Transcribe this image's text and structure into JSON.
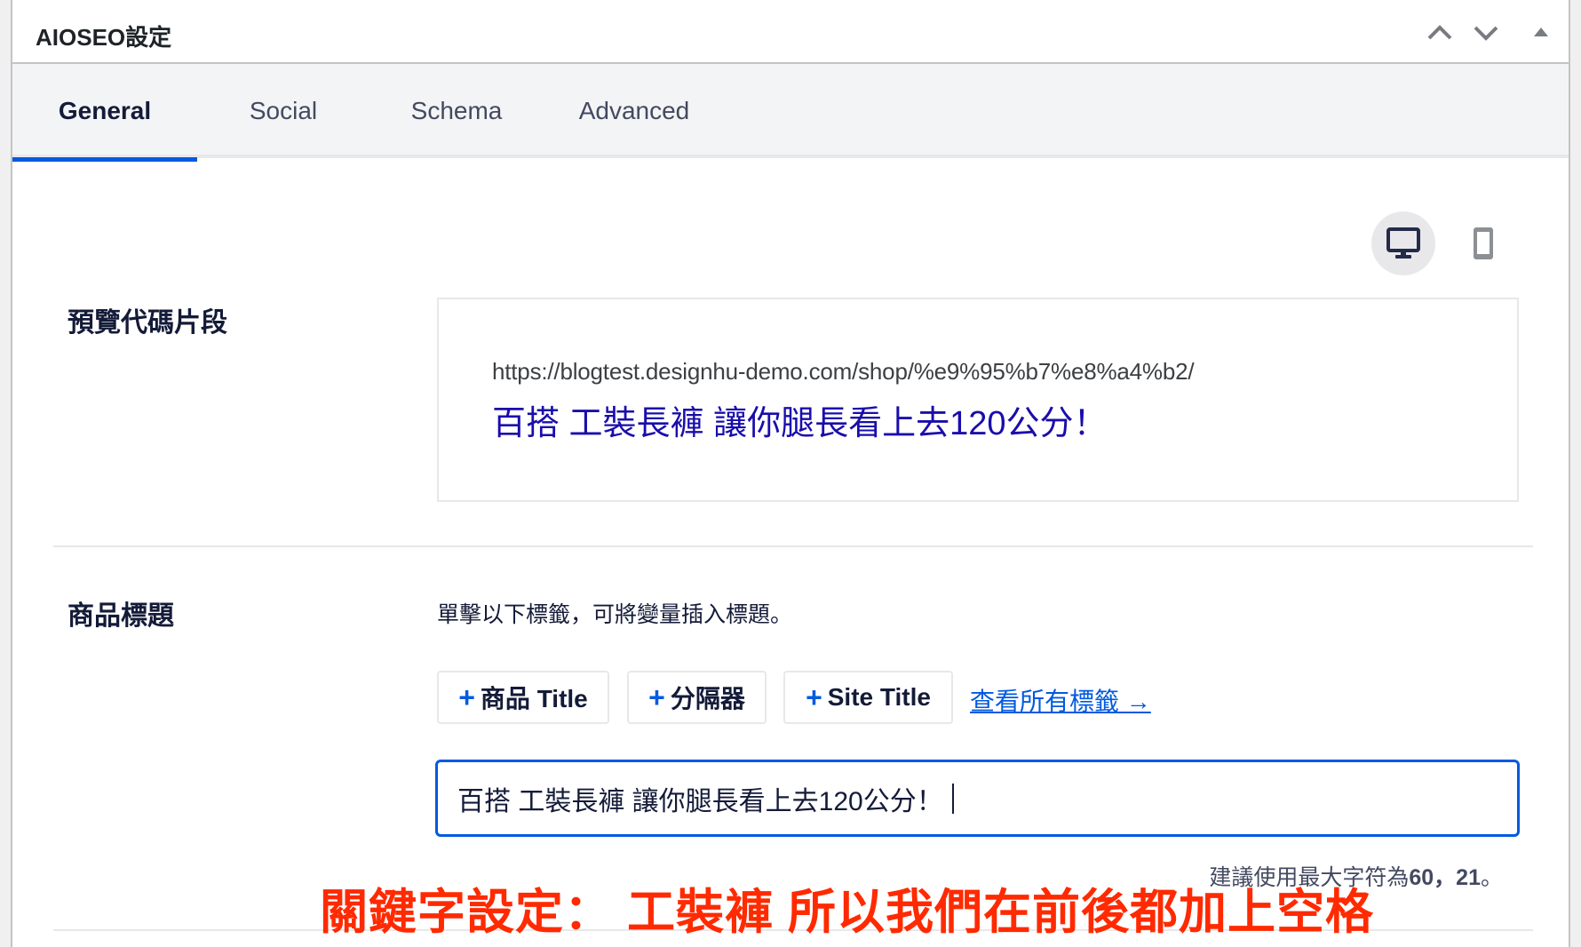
{
  "header": {
    "title": "AIOSEO設定",
    "icons": [
      "chevron-up-icon",
      "chevron-down-icon",
      "triangle-up-icon"
    ]
  },
  "tabs": [
    {
      "label": "General",
      "active": true
    },
    {
      "label": "Social",
      "active": false
    },
    {
      "label": "Schema",
      "active": false
    },
    {
      "label": "Advanced",
      "active": false
    }
  ],
  "device_toggle": {
    "options": [
      {
        "name": "desktop",
        "icon": "desktop-icon",
        "active": true
      },
      {
        "name": "mobile",
        "icon": "mobile-icon",
        "active": false
      }
    ]
  },
  "snippet": {
    "label": "預覽代碼片段",
    "url": "https://blogtest.designhu-demo.com/shop/%e9%95%b7%e8%a4%b2/",
    "title": "百搭 工裝長褲 讓你腿長看上去120公分！"
  },
  "product_title": {
    "label": "商品標題",
    "hint": "單擊以下標籤，可將變量插入標題。",
    "tags": [
      {
        "plus": "+",
        "label": "商品 Title"
      },
      {
        "plus": "+",
        "label": "分隔器"
      },
      {
        "plus": "+",
        "label": "Site Title"
      }
    ],
    "view_all_link": "查看所有標籤 →",
    "input_value": "百搭 工裝長褲 讓你腿長看上去120公分！",
    "char_count_prefix": "建議使用最大字符為",
    "char_count_max": "60",
    "char_count_sep": "，",
    "char_count_current": "21",
    "char_count_suffix": "。"
  },
  "annotation": {
    "text": "關鍵字設定： 工裝褲 所以我們在前後都加上空格",
    "color": "#ff2a00"
  },
  "colors": {
    "accent": "#005ae0",
    "link_title": "#1a0dab",
    "text_dark": "#141b38"
  }
}
